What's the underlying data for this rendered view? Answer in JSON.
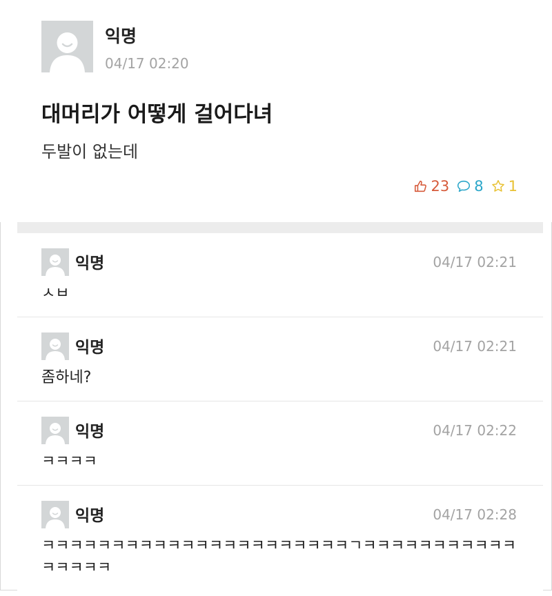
{
  "post": {
    "author": "익명",
    "timestamp": "04/17 02:20",
    "title": "대머리가 어떻게 걸어다녀",
    "body": "두발이 없는데",
    "likes": "23",
    "comments": "8",
    "scraps": "1",
    "icons": {
      "like": "thumbs-up-icon",
      "comment": "speech-bubble-icon",
      "scrap": "star-icon"
    },
    "colors": {
      "like": "#d65a3a",
      "comment": "#2aa6c9",
      "scrap": "#e8c132"
    }
  },
  "comment_list": [
    {
      "author": "익명",
      "timestamp": "04/17 02:21",
      "text": "ㅅㅂ"
    },
    {
      "author": "익명",
      "timestamp": "04/17 02:21",
      "text": "좀하네?"
    },
    {
      "author": "익명",
      "timestamp": "04/17 02:22",
      "text": "ㅋㅋㅋㅋ"
    },
    {
      "author": "익명",
      "timestamp": "04/17 02:28",
      "text": "ㅋㅋㅋㅋㅋㅋㅋㅋㅋㅋㅋㅋㅋㅋㅋㅋㅋㅋㅋㅋㅋㅋㄱㅋㅋㅋㅋㅋㅋㅋㅋㅋㅋㅋㅋㅋㅋㅋㅋ"
    }
  ]
}
